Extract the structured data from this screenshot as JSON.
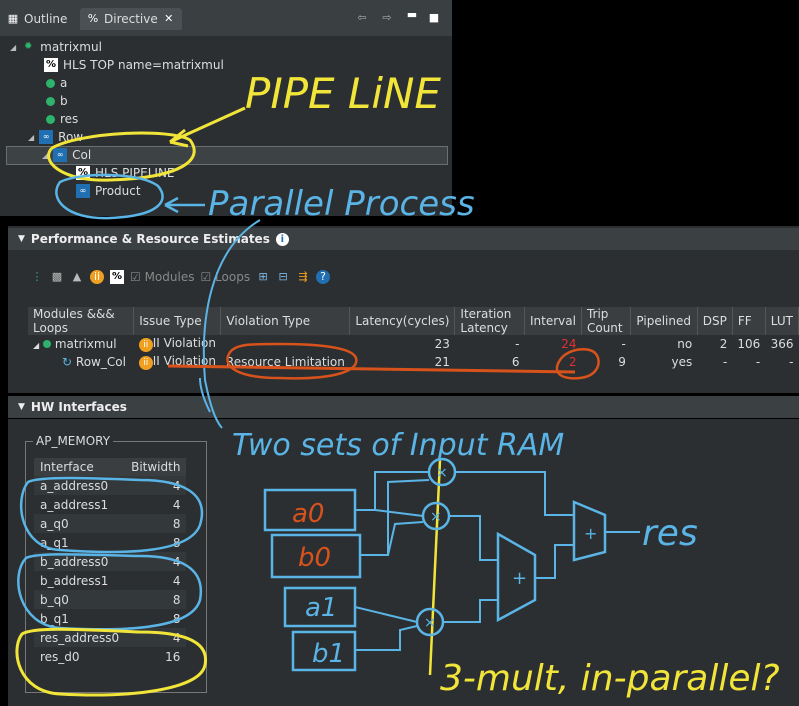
{
  "tabs": {
    "outline": "Outline",
    "directive": "Directive"
  },
  "tree": {
    "top": "matrixmul",
    "hls_top": "HLS TOP name=matrixmul",
    "ports": [
      "a",
      "b",
      "res"
    ],
    "row": "Row",
    "col": "Col",
    "pipeline": "HLS PIPELINE",
    "product": "Product"
  },
  "perf": {
    "title": "Performance & Resource Estimates",
    "toolbar": {
      "modules": "Modules",
      "loops": "Loops"
    },
    "columns": [
      "Modules &&& Loops",
      "Issue Type",
      "Violation Type",
      "Latency(cycles)",
      "Iteration Latency",
      "Interval",
      "Trip Count",
      "Pipelined",
      "DSP",
      "FF",
      "LUT"
    ],
    "rows": [
      {
        "name": "matrixmul",
        "issue": "II Violation",
        "violation": "",
        "latency": "23",
        "iter": "-",
        "interval": "24",
        "trip": "-",
        "pipelined": "no",
        "dsp": "2",
        "ff": "106",
        "lut": "366"
      },
      {
        "name": "Row_Col",
        "issue": "II Violation",
        "violation": "Resource Limitation",
        "latency": "21",
        "iter": "6",
        "interval": "2",
        "trip": "9",
        "pipelined": "yes",
        "dsp": "-",
        "ff": "-",
        "lut": "-"
      }
    ]
  },
  "hw": {
    "title": "HW Interfaces",
    "group": "AP_MEMORY",
    "columns": [
      "Interface",
      "Bitwidth"
    ],
    "rows": [
      {
        "name": "a_address0",
        "bits": "4"
      },
      {
        "name": "a_address1",
        "bits": "4"
      },
      {
        "name": "a_q0",
        "bits": "8"
      },
      {
        "name": "a_q1",
        "bits": "8"
      },
      {
        "name": "b_address0",
        "bits": "4"
      },
      {
        "name": "b_address1",
        "bits": "4"
      },
      {
        "name": "b_q0",
        "bits": "8"
      },
      {
        "name": "b_q1",
        "bits": "8"
      },
      {
        "name": "res_address0",
        "bits": "4"
      },
      {
        "name": "res_d0",
        "bits": "16"
      }
    ]
  },
  "annotations": {
    "pipeline": "PIPE LiNE",
    "parallel": "Parallel Process",
    "two_sets": "Two sets of Input RAM",
    "res": "res",
    "a0": "a0",
    "b0": "b0",
    "a1": "a1",
    "b1": "b1",
    "three_mult": "3-mult, in-parallel?"
  },
  "colors": {
    "highlight_yellow": "#f2e53a",
    "blue_ink": "#5ab4e6",
    "orange_ink": "#d8521c",
    "accent_green": "#2db36b"
  }
}
